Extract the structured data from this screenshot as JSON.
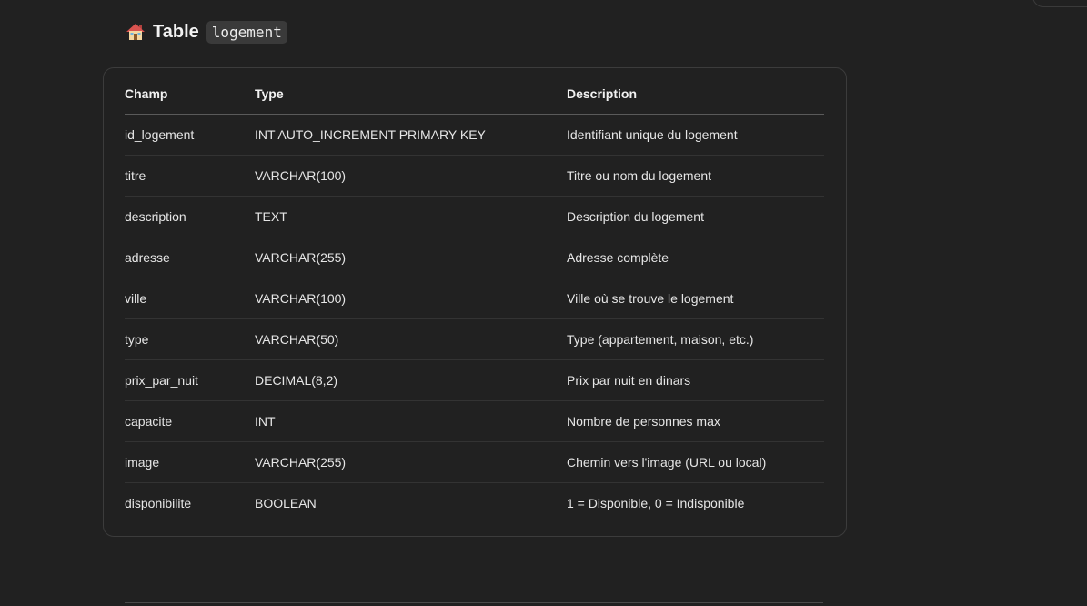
{
  "heading": {
    "icon": "house-icon",
    "word": "Table",
    "code": "logement"
  },
  "table": {
    "headers": [
      "Champ",
      "Type",
      "Description"
    ],
    "rows": [
      [
        "id_logement",
        "INT AUTO_INCREMENT PRIMARY KEY",
        "Identifiant unique du logement"
      ],
      [
        "titre",
        "VARCHAR(100)",
        "Titre ou nom du logement"
      ],
      [
        "description",
        "TEXT",
        "Description du logement"
      ],
      [
        "adresse",
        "VARCHAR(255)",
        "Adresse complète"
      ],
      [
        "ville",
        "VARCHAR(100)",
        "Ville où se trouve le logement"
      ],
      [
        "type",
        "VARCHAR(50)",
        "Type (appartement, maison, etc.)"
      ],
      [
        "prix_par_nuit",
        "DECIMAL(8,2)",
        "Prix par nuit en dinars"
      ],
      [
        "capacite",
        "INT",
        "Nombre de personnes max"
      ],
      [
        "image",
        "VARCHAR(255)",
        "Chemin vers l'image (URL ou local)"
      ],
      [
        "disponibilite",
        "BOOLEAN",
        "1 = Disponible, 0 = Indisponible"
      ]
    ]
  },
  "colors": {
    "background": "#212121",
    "text": "#ececec",
    "code_background": "#3a3a3a",
    "border": "#3c3c3c"
  }
}
